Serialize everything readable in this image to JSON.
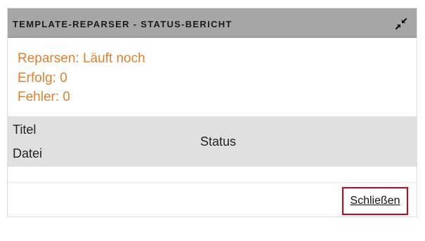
{
  "dialog": {
    "title": "TEMPLATE-REPARSER - STATUS-BERICHT",
    "collapse_icon": "compress-arrows-icon"
  },
  "summary": {
    "reparse_status": "Reparsen: Läuft noch",
    "success": "Erfolg: 0",
    "errors": "Fehler: 0"
  },
  "table": {
    "headers": {
      "title": "Titel",
      "file": "Datei",
      "status": "Status"
    },
    "rows": []
  },
  "footer": {
    "close_label": "Schließen"
  },
  "colors": {
    "titlebar_bg": "#a6a6a6",
    "summary_text": "#e27f2d",
    "table_header_bg": "#e0e0e0",
    "focus_outline": "#d0021b"
  }
}
